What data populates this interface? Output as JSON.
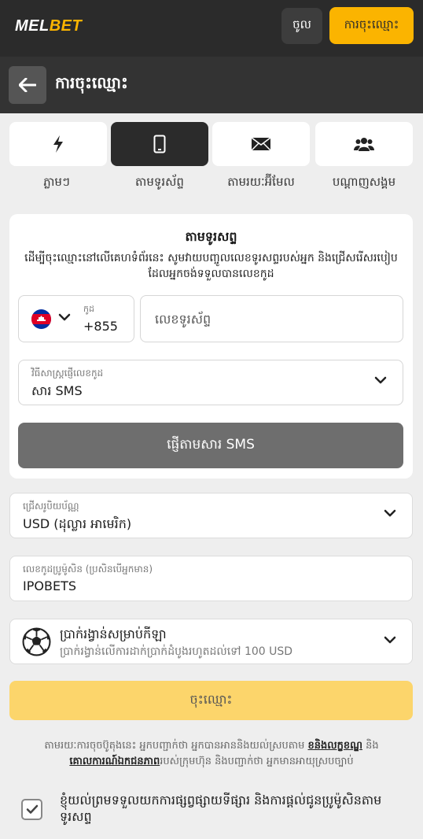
{
  "header": {
    "logo_main": "MEL",
    "logo_accent": "BET",
    "login_label": "ចូល",
    "register_label": "ការចុះឈ្មោះ"
  },
  "titlebar": {
    "back_icon": "arrow-left-icon",
    "title": "ការចុះឈ្មោះ"
  },
  "methods": [
    {
      "icon": "lightning-icon",
      "label": "ភ្លាមៗ",
      "active": false
    },
    {
      "icon": "smartphone-icon",
      "label": "តាមទូរស័ព្ទ",
      "active": true
    },
    {
      "icon": "envelope-icon",
      "label": "តាមរយៈអ៊ីមែល",
      "active": false
    },
    {
      "icon": "users-icon",
      "label": "បណ្ដាញសង្គម",
      "active": false
    }
  ],
  "phone_form": {
    "title": "តាមទូរសព្ទ",
    "description": "ដើម្បីចុះឈ្មោះនៅលើគេហទំព័រនេះ សូមវាយបញ្ចូលលេខទូរសព្ទរបស់អ្នក និងជ្រើសរើសរបៀបដែលអ្នកចង់ទទួលបានលេខកូដ",
    "country_flag": "cambodia-flag-icon",
    "code_label": "កូដ",
    "code_value": "+855",
    "phone_placeholder": "លេខទូរស័ព្ទ",
    "sms_method_label": "វិធីសាស្ត្រផ្ញើលេខកូដ",
    "sms_method_value": "សារ SMS",
    "send_button": "ផ្ញើតាមសារ SMS"
  },
  "currency": {
    "label": "ជ្រើសរូបិយប័ណ្ណ",
    "value": "USD (ដុល្លារ អាមេរិក)"
  },
  "promo": {
    "label": "លេខកូដប្រូម៉ូសិន (ប្រសិនបើអ្នកមាន)",
    "value": "IPOBETS"
  },
  "bonus": {
    "icon": "soccer-ball-icon",
    "title": "ប្រាក់រង្វាន់សម្រាប់កីឡា",
    "subtitle": "ប្រាក់រង្វាន់លើការដាក់ប្រាក់ដំបូងរហូតដល់ទៅ 100 USD"
  },
  "register_button": "ចុះឈ្មោះ",
  "terms": {
    "part1": "តាមរយៈការចុចប៊ូតុងនេះ អ្នកបញ្ជាក់ថា អ្នកបានអាននិងយល់ស្របតាម ",
    "link1": "ខនិងលក្ខខណ្ឌ",
    "part2": " និង ",
    "link2": "គោលការណ៍ឯកជនភាព",
    "part3": "របស់ក្រុមហ៊ុន និងបញ្ជាក់ថា អ្នកមានអាយុស្របច្បាប់"
  },
  "consent": {
    "checked": true,
    "text": "ខ្ញុំយល់ព្រមទទួលយកការផ្សព្វផ្សាយទីផ្សារ និងការផ្ដល់ជូនប្រូម៉ូសិនតាមទូរសព្ទ"
  },
  "colors": {
    "accent": "#fbb400",
    "header_bg": "#2b2b2b",
    "page_bg": "#eeeeee"
  }
}
